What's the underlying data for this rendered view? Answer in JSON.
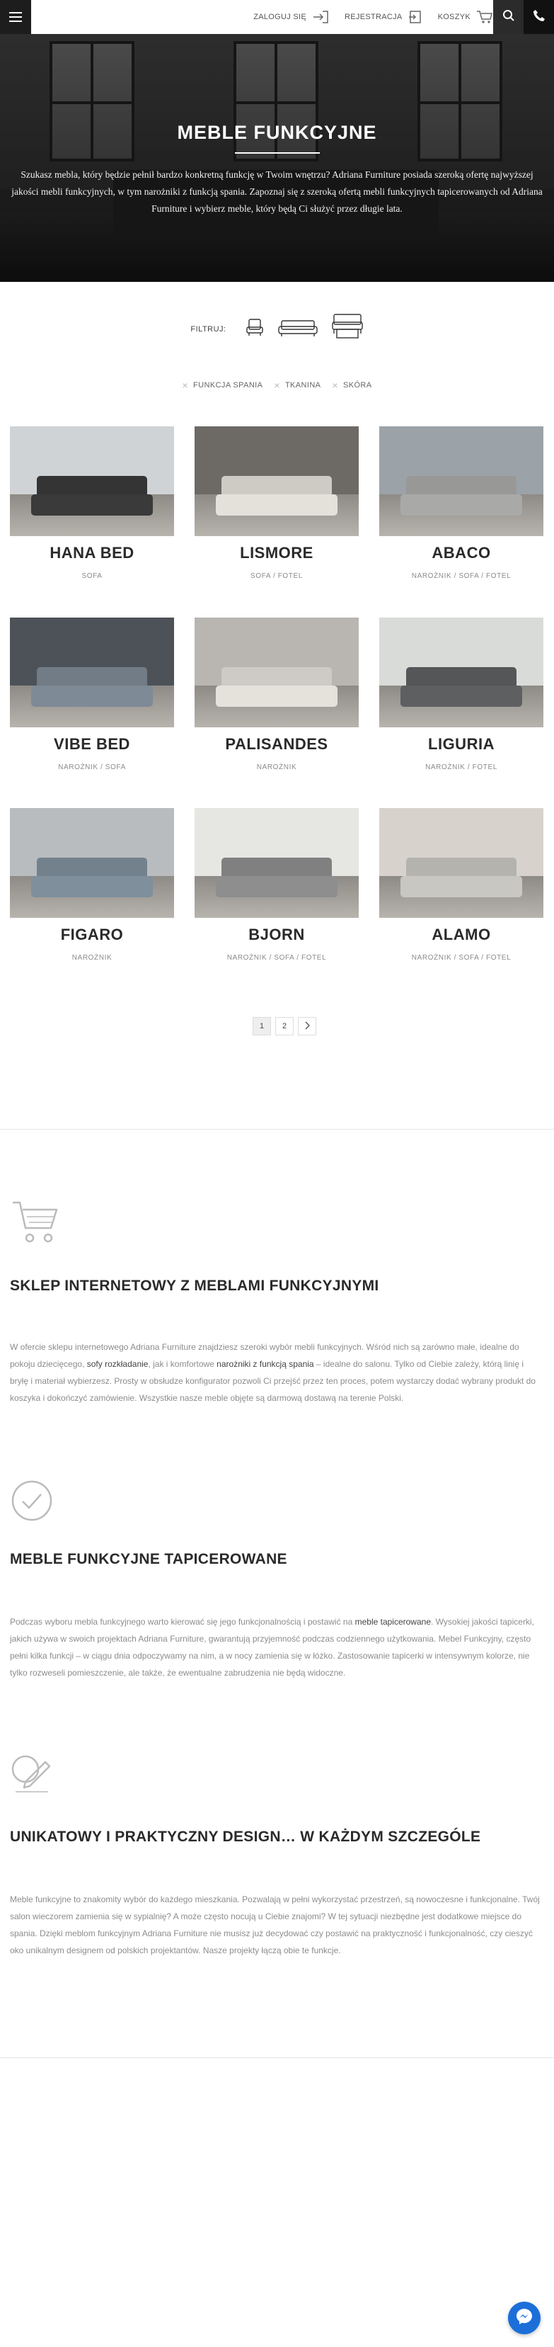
{
  "header": {
    "login_label": "ZALOGUJ SIĘ",
    "register_label": "REJESTRACJA",
    "cart_label": "KOSZYK"
  },
  "hero": {
    "title": "MEBLE FUNKCYJNE",
    "description": "Szukasz mebla, który będzie pełnił bardzo konkretną funkcję w Twoim wnętrzu? Adriana Furniture posiada szeroką ofertę najwyższej jakości mebli funkcyjnych, w tym narożniki z funkcją spania. Zapoznaj się z szeroką ofertą mebli funkcyjnych tapicerowanych od Adriana Furniture i wybierz meble, który będą Ci służyć przez długie lata."
  },
  "filters": {
    "label": "FILTRUJ:",
    "icons": [
      "armchair-icon",
      "sofa-icon",
      "sofa-bed-icon"
    ],
    "active_tags": [
      "FUNKCJA SPANIA",
      "TKANINA",
      "SKÓRA"
    ]
  },
  "products": [
    {
      "name": "HANA BED",
      "type": "SOFA",
      "sofa_color": "#3a3a3a",
      "bg": "#cfd3d6"
    },
    {
      "name": "LISMORE",
      "type": "SOFA / FOTEL",
      "sofa_color": "#e4e1da",
      "bg": "#6d6a66"
    },
    {
      "name": "ABACO",
      "type": "NAROŻNIK / SOFA / FOTEL",
      "sofa_color": "#a9aaa8",
      "bg": "#9ba3a8"
    },
    {
      "name": "VIBE BED",
      "type": "NAROŻNIK / SOFA",
      "sofa_color": "#7e8a95",
      "bg": "#4d5258"
    },
    {
      "name": "PALISANDES",
      "type": "NAROŻNIK",
      "sofa_color": "#e5e2dc",
      "bg": "#b9b6b1"
    },
    {
      "name": "LIGURIA",
      "type": "NAROŻNIK / FOTEL",
      "sofa_color": "#5d5f61",
      "bg": "#d9dbd9"
    },
    {
      "name": "FIGARO",
      "type": "NAROŻNIK",
      "sofa_color": "#7f8f9c",
      "bg": "#b8bcbf"
    },
    {
      "name": "BJORN",
      "type": "NAROŻNIK / SOFA / FOTEL",
      "sofa_color": "#8d8e8d",
      "bg": "#e6e6e3"
    },
    {
      "name": "ALAMO",
      "type": "NAROŻNIK / SOFA / FOTEL",
      "sofa_color": "#c9c7c1",
      "bg": "#d7d3cc"
    }
  ],
  "pagination": {
    "pages": [
      "1",
      "2"
    ],
    "current": "1",
    "next_icon": "chevron-right-icon"
  },
  "sections": [
    {
      "icon": "cart-icon",
      "title": "SKLEP INTERNETOWY Z MEBLAMI FUNKCYJNYMI",
      "text_a": "W ofercie sklepu internetowego Adriana Furniture znajdziesz szeroki wybór mebli funkcyjnych. Wśród nich są zarówno małe, idealne do pokoju dziecięcego, ",
      "link_a": "sofy rozkładanie",
      "text_b": ", jak i komfortowe ",
      "link_b": "narożniki z funkcją spania",
      "text_c": " – idealne do salonu. Tylko od Ciebie zależy, którą linię i bryłę i materiał wybierzesz. Prosty w obsłudze konfigurator pozwoli Ci przejść przez ten proces, potem wystarczy dodać wybrany produkt do koszyka i dokończyć zamówienie. Wszystkie nasze meble objęte są darmową dostawą na terenie Polski."
    },
    {
      "icon": "checkmark-circle-icon",
      "title": "MEBLE FUNKCYJNE TAPICEROWANE",
      "text_a": "Podczas wyboru mebla funkcyjnego warto kierować się jego funkcjonalnością i postawić na ",
      "link_a": "meble tapicerowane",
      "text_b": ". Wysokiej jakości tapicerki, jakich używa w swoich projektach Adriana Furniture, gwarantują przyjemność podczas codziennego użytkowania. Mebel Funkcyjny, często pełni kilka funkcji – w ciągu dnia odpoczywamy na nim, a w nocy zamienia się w łóżko. Zastosowanie tapicerki w intensywnym kolorze, nie tylko rozweseli pomieszczenie, ale także, że ewentualne zabrudzenia nie będą widoczne."
    },
    {
      "icon": "design-pencil-icon",
      "title": "UNIKATOWY I PRAKTYCZNY DESIGN… W KAŻDYM SZCZEGÓLE",
      "text_a": "Meble funkcyjne to znakomity wybór do każdego mieszkania. Pozwalają w pełni wykorzystać przestrzeń, są nowoczesne i funkcjonalne. Twój salon wieczorem zamienia się w sypialnię? A może często nocują u Ciebie znajomi? W tej sytuacji niezbędne jest dodatkowe miejsce do spania. Dzięki meblom funkcyjnym Adriana Furniture nie musisz już decydować czy postawić na praktyczność i funkcjonalność, czy cieszyć oko unikalnym designem od polskich projektantów. Nasze projekty łączą obie te funkcje."
    }
  ],
  "chat": {
    "icon": "messenger-icon"
  }
}
